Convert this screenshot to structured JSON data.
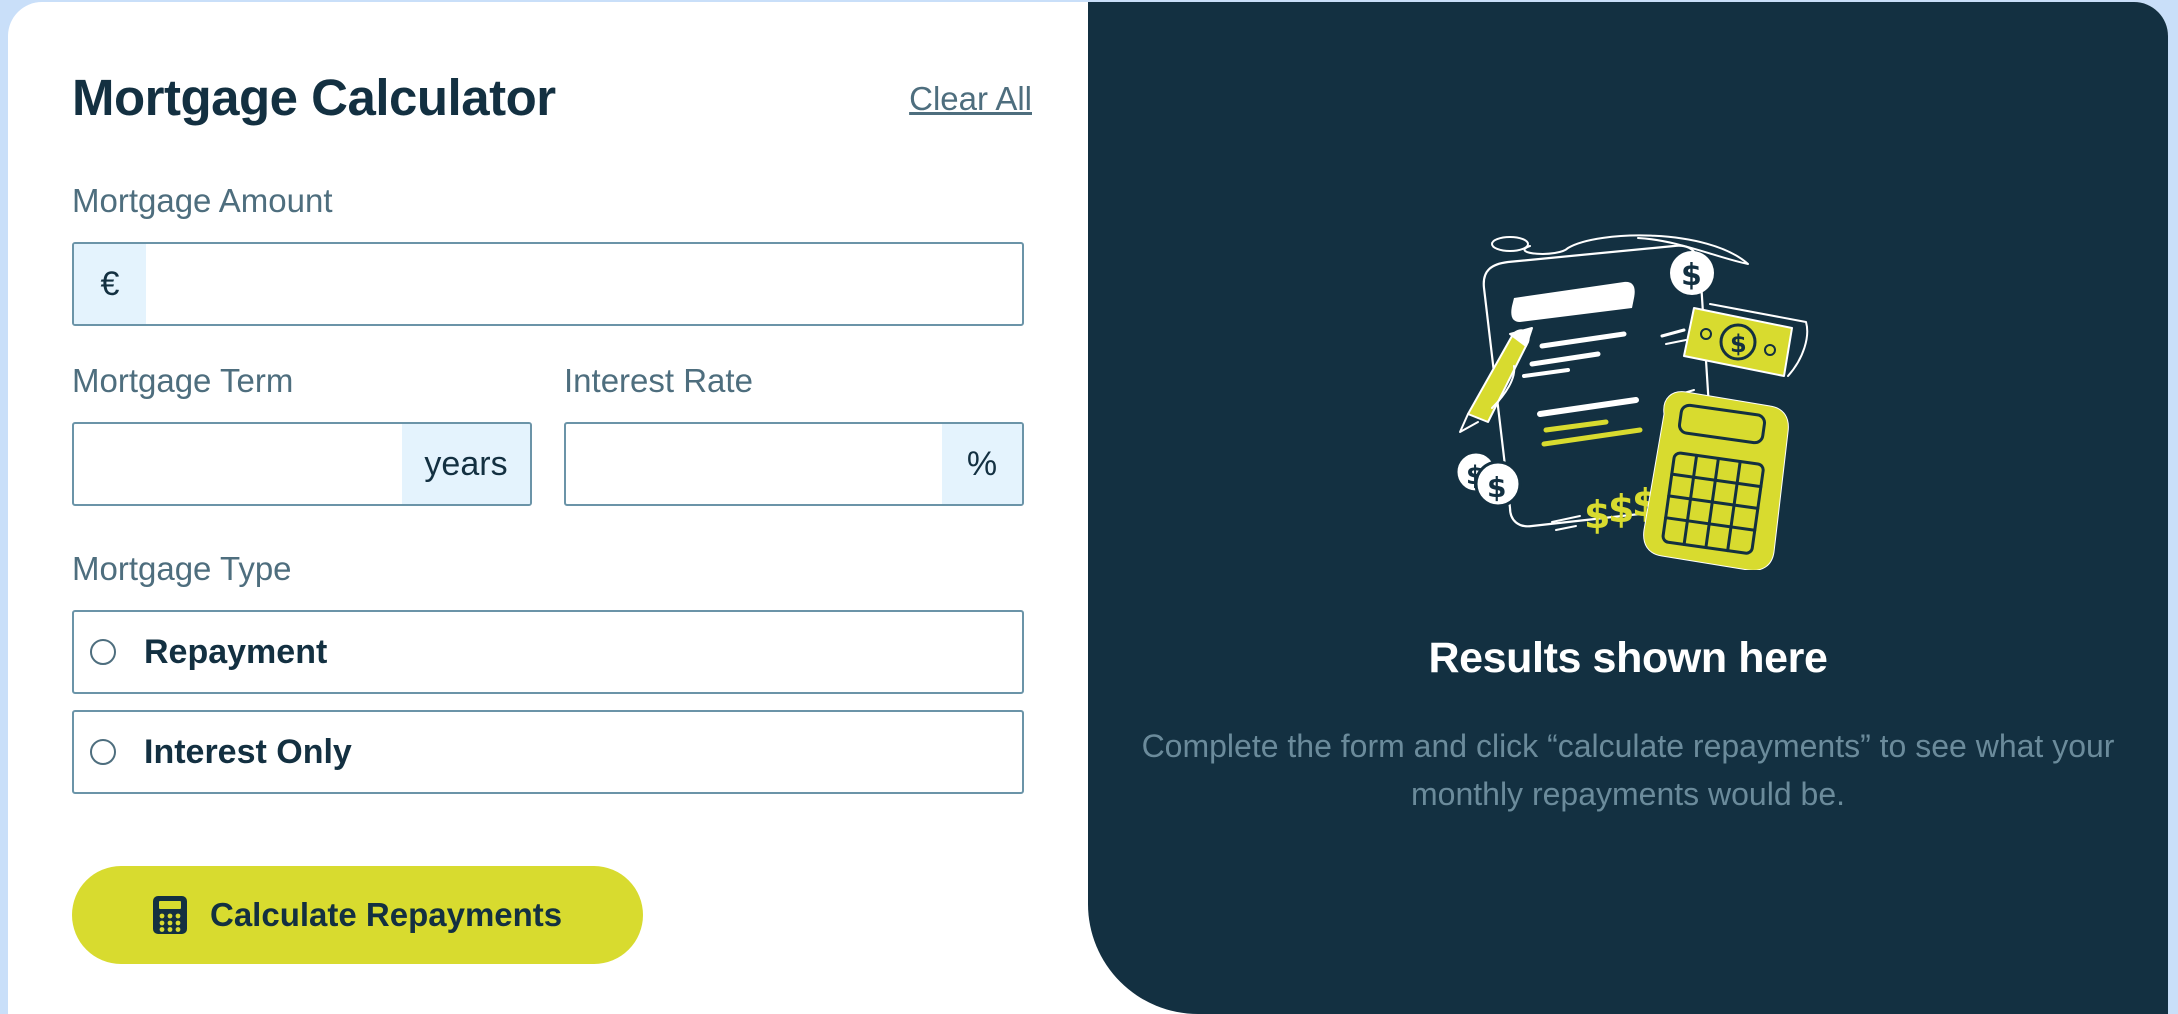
{
  "colors": {
    "page_background": "#c9dff9",
    "card": "#ffffff",
    "dark_panel": "#133041",
    "accent_lime": "#d8db2f",
    "addon_background": "#e4f3fd",
    "label_slate": "#4e6e7e",
    "border_slate": "#6b94a8"
  },
  "form": {
    "title": "Mortgage Calculator",
    "clear_all": "Clear All",
    "amount": {
      "label": "Mortgage Amount",
      "prefix": "€",
      "value": ""
    },
    "term": {
      "label": "Mortgage Term",
      "suffix": "years",
      "value": ""
    },
    "rate": {
      "label": "Interest Rate",
      "suffix": "%",
      "value": ""
    },
    "type": {
      "label": "Mortgage Type",
      "options": [
        {
          "label": "Repayment",
          "selected": false
        },
        {
          "label": "Interest Only",
          "selected": false
        }
      ]
    },
    "submit": {
      "label": "Calculate Repayments",
      "icon": "calculator-icon"
    }
  },
  "results": {
    "illustration": "empty-results-illustration",
    "title": "Results shown here",
    "description": "Complete the form and click “calculate repayments” to see what your monthly repayments would be."
  }
}
